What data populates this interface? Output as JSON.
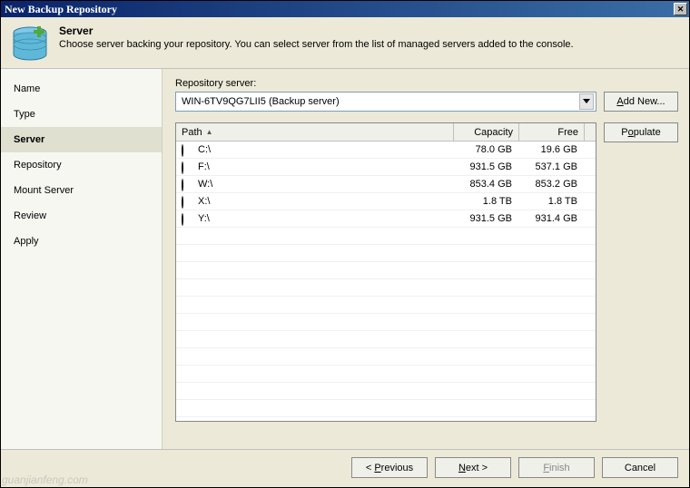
{
  "window": {
    "title": "New Backup Repository"
  },
  "header": {
    "title": "Server",
    "description": "Choose server backing your repository. You can select server from the list of managed servers added to the console."
  },
  "sidebar": {
    "items": [
      {
        "label": "Name"
      },
      {
        "label": "Type"
      },
      {
        "label": "Server"
      },
      {
        "label": "Repository"
      },
      {
        "label": "Mount Server"
      },
      {
        "label": "Review"
      },
      {
        "label": "Apply"
      }
    ],
    "selected_index": 2
  },
  "main": {
    "repo_label": "Repository server:",
    "repo_value": "WIN-6TV9QG7LII5 (Backup server)",
    "addnew_label": "Add New...",
    "populate_label": "Populate",
    "columns": {
      "path": "Path",
      "capacity": "Capacity",
      "free": "Free"
    },
    "rows": [
      {
        "iconClass": "disk-blue",
        "path": "C:\\",
        "capacity": "78.0 GB",
        "free": "19.6 GB"
      },
      {
        "iconClass": "disk-pink",
        "path": "F:\\",
        "capacity": "931.5 GB",
        "free": "537.1 GB"
      },
      {
        "iconClass": "disk-pink",
        "path": "W:\\",
        "capacity": "853.4 GB",
        "free": "853.2 GB"
      },
      {
        "iconClass": "disk-pink",
        "path": "X:\\",
        "capacity": "1.8 TB",
        "free": "1.8 TB"
      },
      {
        "iconClass": "disk-pink",
        "path": "Y:\\",
        "capacity": "931.5 GB",
        "free": "931.4 GB"
      }
    ]
  },
  "footer": {
    "previous": "Previous",
    "next": "Next",
    "finish": "Finish",
    "cancel": "Cancel"
  },
  "watermark": "guanjianfeng.com"
}
